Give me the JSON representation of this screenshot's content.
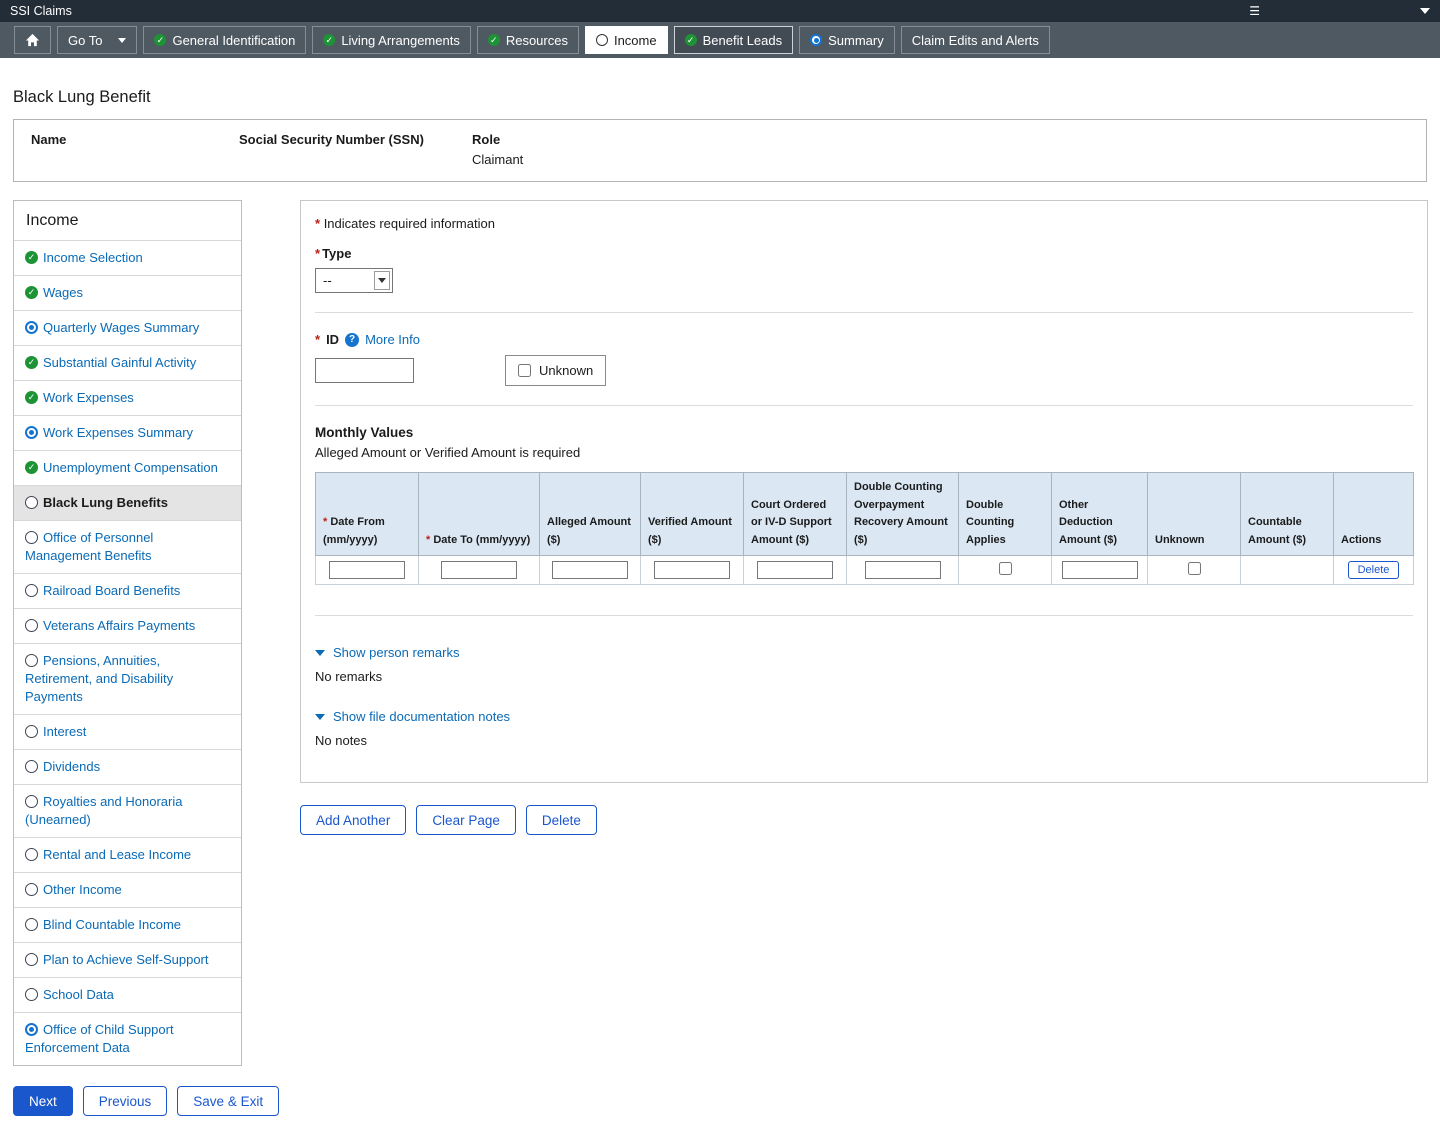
{
  "titlebar": {
    "title": "SSI Claims"
  },
  "nav": {
    "goto_label": "Go To",
    "tabs": [
      {
        "label": "General Identification",
        "icon": "check-circle"
      },
      {
        "label": "Living Arrangements",
        "icon": "check-circle"
      },
      {
        "label": "Resources",
        "icon": "check-circle"
      },
      {
        "label": "Income",
        "icon": "empty-circle",
        "state": "active"
      },
      {
        "label": "Benefit Leads",
        "icon": "check-circle",
        "state": "focused"
      },
      {
        "label": "Summary",
        "icon": "in-progress-circle"
      },
      {
        "label": "Claim Edits and Alerts",
        "icon": "none"
      }
    ]
  },
  "page": {
    "title": "Black Lung Benefit"
  },
  "person": {
    "name_label": "Name",
    "ssn_label": "Social Security Number (SSN)",
    "role_label": "Role",
    "role_value": "Claimant"
  },
  "sidebar": {
    "title": "Income",
    "items": [
      {
        "label": "Income Selection",
        "icon": "check-circle"
      },
      {
        "label": "Wages",
        "icon": "check-circle"
      },
      {
        "label": "Quarterly Wages Summary",
        "icon": "in-progress-circle"
      },
      {
        "label": "Substantial Gainful Activity",
        "icon": "check-circle"
      },
      {
        "label": "Work Expenses",
        "icon": "check-circle"
      },
      {
        "label": "Work Expenses Summary",
        "icon": "in-progress-circle"
      },
      {
        "label": "Unemployment Compensation",
        "icon": "check-circle"
      },
      {
        "label": "Black Lung Benefits",
        "icon": "empty-circle",
        "state": "selected"
      },
      {
        "label": "Office of Personnel Management Benefits",
        "icon": "empty-circle"
      },
      {
        "label": "Railroad Board Benefits",
        "icon": "empty-circle"
      },
      {
        "label": "Veterans Affairs Payments",
        "icon": "empty-circle"
      },
      {
        "label": "Pensions, Annuities, Retirement, and Disability Payments",
        "icon": "empty-circle"
      },
      {
        "label": "Interest",
        "icon": "empty-circle"
      },
      {
        "label": "Dividends",
        "icon": "empty-circle"
      },
      {
        "label": "Royalties and Honoraria (Unearned)",
        "icon": "empty-circle"
      },
      {
        "label": "Rental and Lease Income",
        "icon": "empty-circle"
      },
      {
        "label": "Other Income",
        "icon": "empty-circle"
      },
      {
        "label": "Blind Countable Income",
        "icon": "empty-circle"
      },
      {
        "label": "Plan to Achieve Self-Support",
        "icon": "empty-circle"
      },
      {
        "label": "School Data",
        "icon": "empty-circle"
      },
      {
        "label": "Office of Child Support Enforcement Data",
        "icon": "in-progress-circle"
      }
    ]
  },
  "form": {
    "required_note": "Indicates required information",
    "type_label": "Type",
    "type_value": "--",
    "id_label": "ID",
    "more_info_label": "More Info",
    "id_value": "",
    "unknown_label": "Unknown"
  },
  "table": {
    "title": "Monthly Values",
    "subtitle": "Alleged Amount or Verified Amount is required",
    "columns": [
      {
        "label": "Date From (mm/yyyy)",
        "required": true
      },
      {
        "label": "Date To (mm/yyyy)",
        "required": true
      },
      {
        "label": "Alleged Amount ($)",
        "required": false
      },
      {
        "label": "Verified Amount ($)",
        "required": false
      },
      {
        "label": "Court Ordered or IV-D Support Amount ($)",
        "required": false
      },
      {
        "label": "Double Counting Overpayment Recovery Amount ($)",
        "required": false
      },
      {
        "label": "Double Counting Applies",
        "required": false
      },
      {
        "label": "Other Deduction Amount ($)",
        "required": false
      },
      {
        "label": "Unknown",
        "required": false
      },
      {
        "label": "Countable Amount ($)",
        "required": false
      },
      {
        "label": "Actions",
        "required": false
      }
    ],
    "row_delete_label": "Delete"
  },
  "remarks": {
    "toggle_label": "Show person remarks",
    "empty_text": "No remarks"
  },
  "notes": {
    "toggle_label": "Show file documentation notes",
    "empty_text": "No notes"
  },
  "actions": {
    "add_label": "Add Another",
    "clear_label": "Clear Page",
    "delete_label": "Delete"
  },
  "footer": {
    "next_label": "Next",
    "previous_label": "Previous",
    "save_exit_label": "Save & Exit"
  },
  "misc": {
    "required_marker": "*"
  }
}
